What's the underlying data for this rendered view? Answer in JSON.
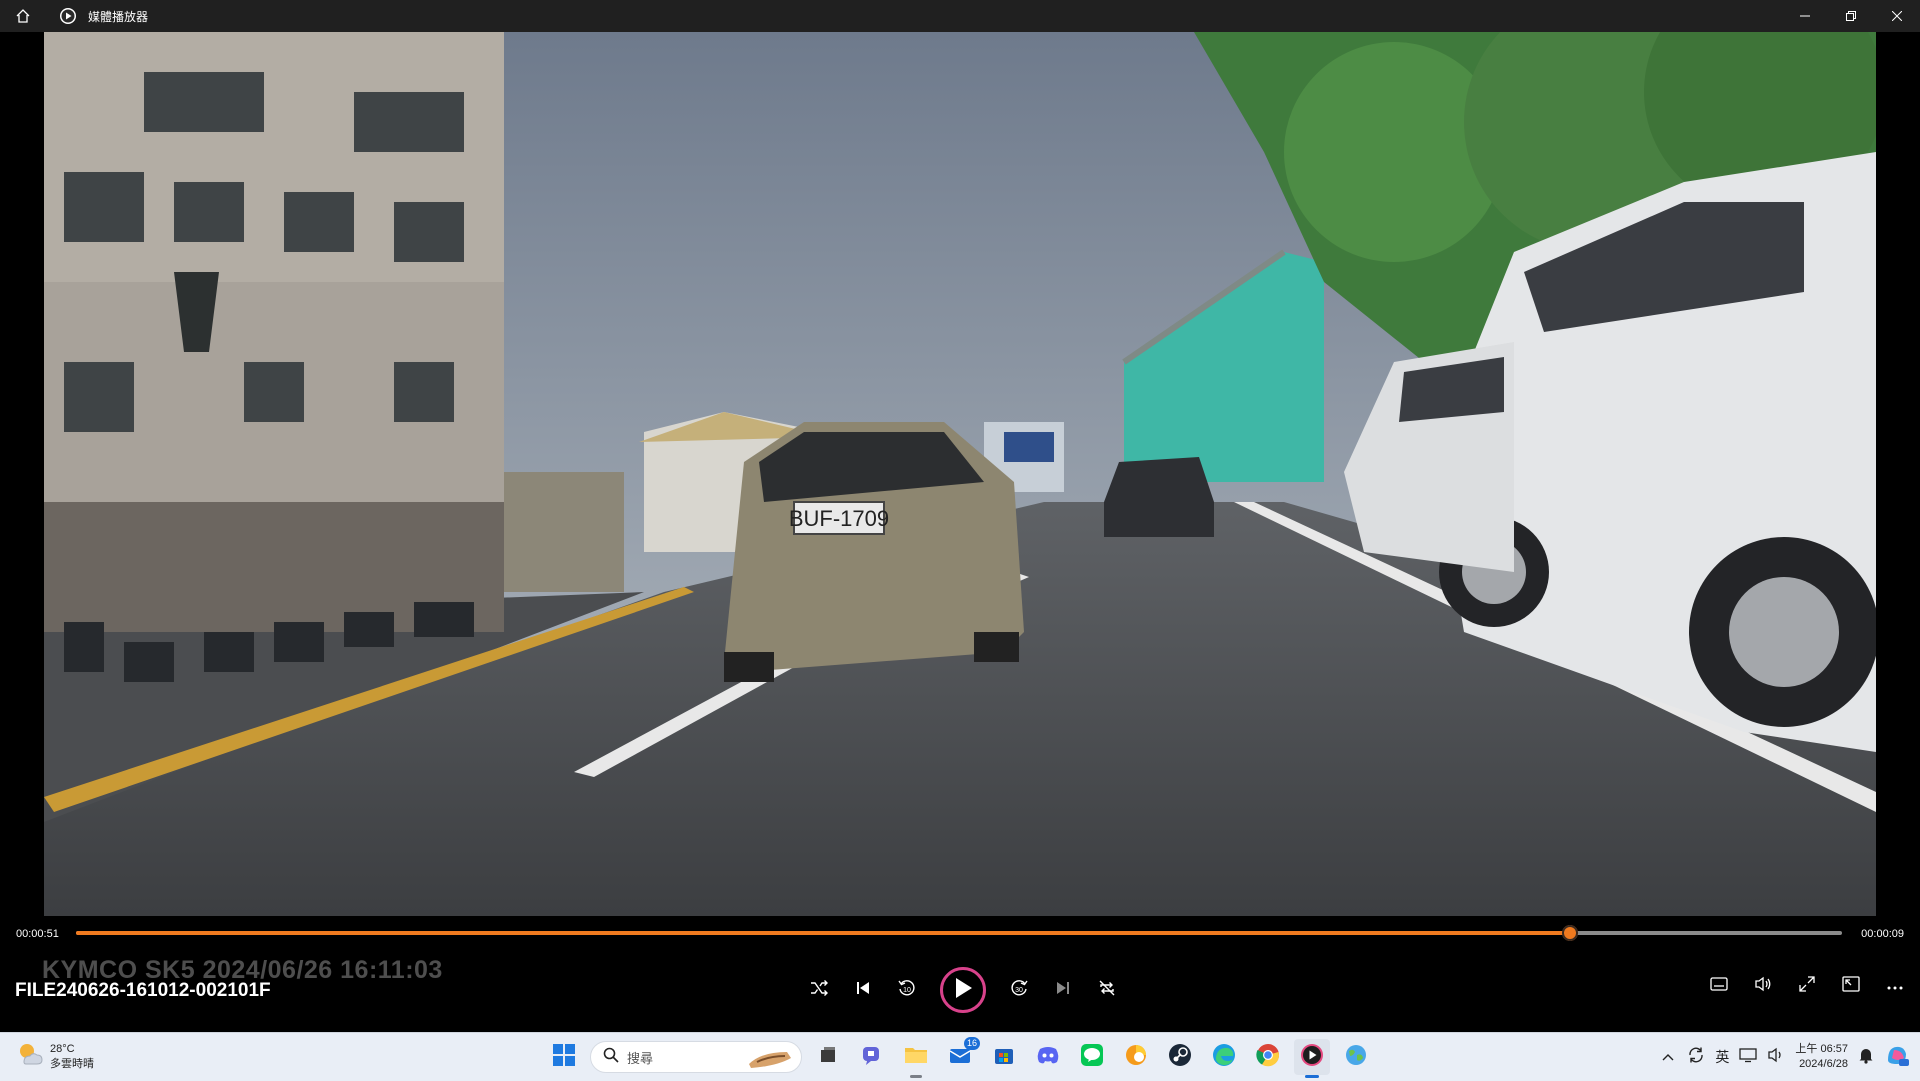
{
  "window": {
    "title": "媒體播放器"
  },
  "player": {
    "current_time": "00:00:51",
    "remaining_time": "00:00:09",
    "progress": 0.846,
    "overlay_text": "KYMCO SK5   2024/06/26 16:11:03",
    "file_name": "FILE240626-161012-002101F",
    "accent_color": "#f07a1f",
    "play_ring_color": "#d8428b"
  },
  "video_scene": {
    "plate_text": "BUF-1709"
  },
  "taskbar": {
    "weather": {
      "temp": "28°C",
      "condition": "多雲時晴"
    },
    "search_placeholder": "搜尋",
    "mail_badge": "16",
    "ime": "英",
    "clock_time": "上午 06:57",
    "clock_date": "2024/6/28"
  }
}
